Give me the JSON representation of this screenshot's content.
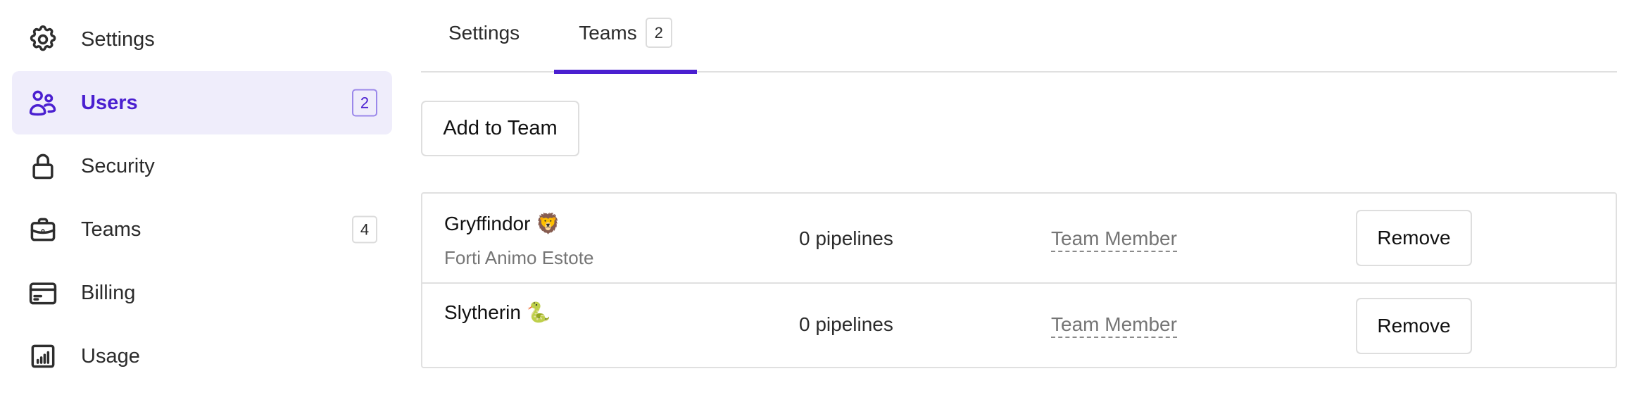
{
  "sidebar": {
    "items": [
      {
        "label": "Settings",
        "icon": "gear-icon",
        "badge": null,
        "active": false
      },
      {
        "label": "Users",
        "icon": "users-icon",
        "badge": "2",
        "active": true
      },
      {
        "label": "Security",
        "icon": "lock-icon",
        "badge": null,
        "active": false
      },
      {
        "label": "Teams",
        "icon": "briefcase-icon",
        "badge": "4",
        "active": false
      },
      {
        "label": "Billing",
        "icon": "credit-card-icon",
        "badge": null,
        "active": false
      },
      {
        "label": "Usage",
        "icon": "bar-chart-icon",
        "badge": null,
        "active": false
      }
    ]
  },
  "tabs": [
    {
      "label": "Settings",
      "badge": null,
      "active": false
    },
    {
      "label": "Teams",
      "badge": "2",
      "active": true
    }
  ],
  "actions": {
    "add_to_team_label": "Add to Team"
  },
  "teams": [
    {
      "name": "Gryffindor 🦁",
      "description": "Forti Animo Estote",
      "pipelines": "0 pipelines",
      "role": "Team Member",
      "remove_label": "Remove"
    },
    {
      "name": "Slytherin 🐍",
      "description": "",
      "pipelines": "0 pipelines",
      "role": "Team Member",
      "remove_label": "Remove"
    }
  ],
  "colors": {
    "accent": "#4a1fd0",
    "active_bg": "#efedfb",
    "border": "#e0e0e0",
    "muted_text": "#757575"
  }
}
